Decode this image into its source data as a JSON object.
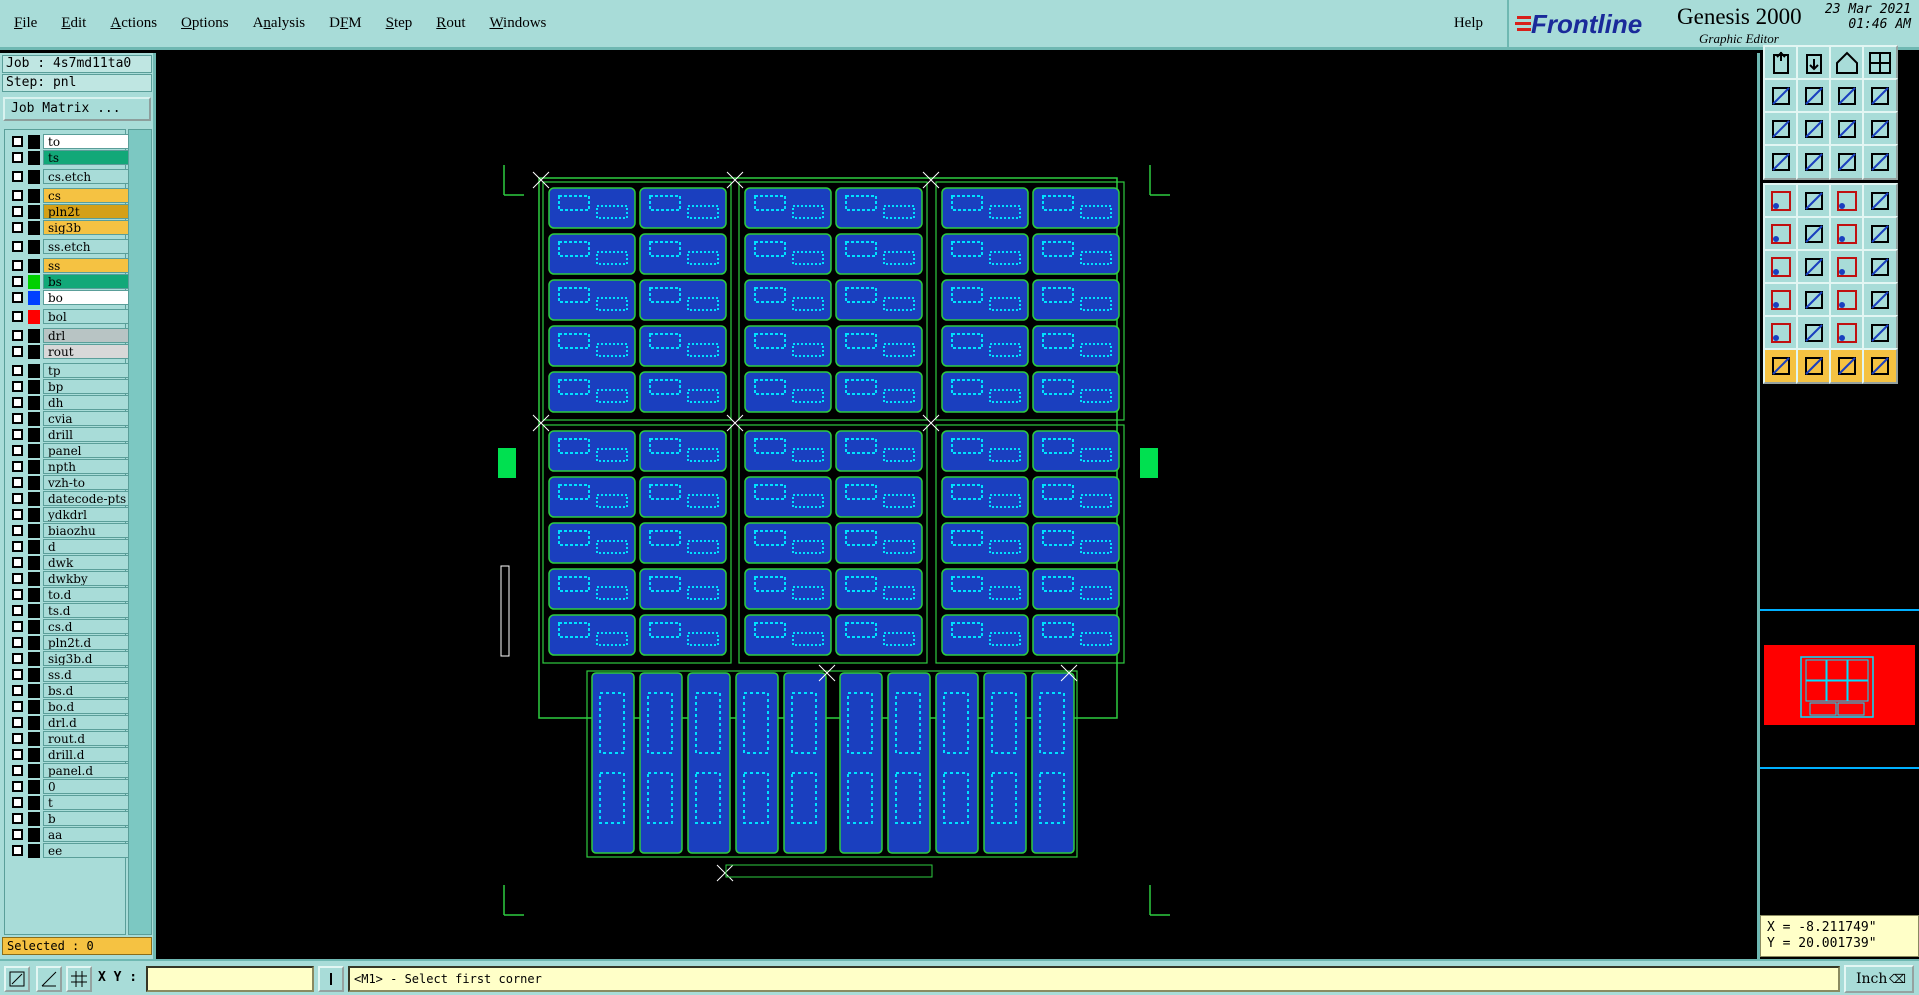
{
  "menu": {
    "items": [
      {
        "key": "file",
        "label": "File"
      },
      {
        "key": "edit",
        "label": "Edit"
      },
      {
        "key": "actions",
        "label": "Actions"
      },
      {
        "key": "options",
        "label": "Options"
      },
      {
        "key": "analysis",
        "label": "Analysis"
      },
      {
        "key": "dfm",
        "label": "DFM"
      },
      {
        "key": "step",
        "label": "Step"
      },
      {
        "key": "rout",
        "label": "Rout"
      },
      {
        "key": "windows",
        "label": "Windows"
      }
    ],
    "help": "Help"
  },
  "brand": {
    "logo": "Frontline",
    "product": "Genesis 2000",
    "subtitle": "Graphic Editor",
    "date": "23 Mar 2021",
    "time": "01:46 AM"
  },
  "job": {
    "job_line": "Job : 4s7md11ta0",
    "step_line": "Step: pnl",
    "matrix_button": "Job Matrix ..."
  },
  "layers": [
    {
      "name": "to",
      "color": "#ffffff",
      "swatch": "#000000",
      "gap": false
    },
    {
      "name": "ts",
      "color": "#12a878",
      "swatch": "#000000",
      "gap": false
    },
    {
      "name": "cs.etch",
      "color": "#a8dcd8",
      "swatch": "#000000",
      "gap": true
    },
    {
      "name": "cs",
      "color": "#f5c242",
      "swatch": "#000000",
      "gap": true
    },
    {
      "name": "pln2t",
      "color": "#d4a017",
      "swatch": "#000000",
      "gap": false
    },
    {
      "name": "sig3b",
      "color": "#f5c242",
      "swatch": "#000000",
      "gap": false
    },
    {
      "name": "ss.etch",
      "color": "#a8dcd8",
      "swatch": "#000000",
      "gap": true
    },
    {
      "name": "ss",
      "color": "#f5c242",
      "swatch": "#000000",
      "gap": true
    },
    {
      "name": "bs",
      "color": "#12a878",
      "swatch": "#00d000",
      "gap": false
    },
    {
      "name": "bo",
      "color": "#ffffff",
      "swatch": "#0040ff",
      "gap": false
    },
    {
      "name": "bol",
      "color": "#a8dcd8",
      "swatch": "#ff0000",
      "gap": true
    },
    {
      "name": "drl",
      "color": "#b8c4c4",
      "swatch": "#000000",
      "gap": true
    },
    {
      "name": "rout",
      "color": "#d8d8d8",
      "swatch": "#000000",
      "gap": false
    },
    {
      "name": "tp",
      "color": "#a8dcd8",
      "swatch": "#000000",
      "gap": true
    },
    {
      "name": "bp",
      "color": "#a8dcd8",
      "swatch": "#000000",
      "gap": false
    },
    {
      "name": "dh",
      "color": "#a8dcd8",
      "swatch": "#000000",
      "gap": false
    },
    {
      "name": "cvia",
      "color": "#a8dcd8",
      "swatch": "#000000",
      "gap": false
    },
    {
      "name": "drill",
      "color": "#a8dcd8",
      "swatch": "#000000",
      "gap": false
    },
    {
      "name": "panel",
      "color": "#a8dcd8",
      "swatch": "#000000",
      "gap": false
    },
    {
      "name": "npth",
      "color": "#a8dcd8",
      "swatch": "#000000",
      "gap": false
    },
    {
      "name": "vzh-to",
      "color": "#a8dcd8",
      "swatch": "#000000",
      "gap": false
    },
    {
      "name": "datecode-pts",
      "color": "#a8dcd8",
      "swatch": "#000000",
      "gap": false
    },
    {
      "name": "ydkdrl",
      "color": "#a8dcd8",
      "swatch": "#000000",
      "gap": false
    },
    {
      "name": "biaozhu",
      "color": "#a8dcd8",
      "swatch": "#000000",
      "gap": false
    },
    {
      "name": "d",
      "color": "#a8dcd8",
      "swatch": "#000000",
      "gap": false
    },
    {
      "name": "dwk",
      "color": "#a8dcd8",
      "swatch": "#000000",
      "gap": false
    },
    {
      "name": "dwkby",
      "color": "#a8dcd8",
      "swatch": "#000000",
      "gap": false
    },
    {
      "name": "to.d",
      "color": "#a8dcd8",
      "swatch": "#000000",
      "gap": false
    },
    {
      "name": "ts.d",
      "color": "#a8dcd8",
      "swatch": "#000000",
      "gap": false
    },
    {
      "name": "cs.d",
      "color": "#a8dcd8",
      "swatch": "#000000",
      "gap": false
    },
    {
      "name": "pln2t.d",
      "color": "#a8dcd8",
      "swatch": "#000000",
      "gap": false
    },
    {
      "name": "sig3b.d",
      "color": "#a8dcd8",
      "swatch": "#000000",
      "gap": false
    },
    {
      "name": "ss.d",
      "color": "#a8dcd8",
      "swatch": "#000000",
      "gap": false
    },
    {
      "name": "bs.d",
      "color": "#a8dcd8",
      "swatch": "#000000",
      "gap": false
    },
    {
      "name": "bo.d",
      "color": "#a8dcd8",
      "swatch": "#000000",
      "gap": false
    },
    {
      "name": "drl.d",
      "color": "#a8dcd8",
      "swatch": "#000000",
      "gap": false
    },
    {
      "name": "rout.d",
      "color": "#a8dcd8",
      "swatch": "#000000",
      "gap": false
    },
    {
      "name": "drill.d",
      "color": "#a8dcd8",
      "swatch": "#000000",
      "gap": false
    },
    {
      "name": "panel.d",
      "color": "#a8dcd8",
      "swatch": "#000000",
      "gap": false
    },
    {
      "name": "0",
      "color": "#a8dcd8",
      "swatch": "#000000",
      "gap": false
    },
    {
      "name": "t",
      "color": "#a8dcd8",
      "swatch": "#000000",
      "gap": false
    },
    {
      "name": "b",
      "color": "#a8dcd8",
      "swatch": "#000000",
      "gap": false
    },
    {
      "name": "aa",
      "color": "#a8dcd8",
      "swatch": "#000000",
      "gap": false
    },
    {
      "name": "ee",
      "color": "#a8dcd8",
      "swatch": "#000000",
      "gap": false
    }
  ],
  "selected": "Selected : 0",
  "toolbar_tools": [
    "zoom-home-icon",
    "zoom-back-icon",
    "home-icon",
    "split-window-icon",
    "pan-left-icon",
    "pan-right-icon",
    "undo-zoom-icon",
    "redo-zoom-icon",
    "fit-screen-icon",
    "zoom-vertical-icon",
    "one-to-one-icon",
    "help-icon",
    "snap-icon",
    "grid-icon",
    "layer-toggle-icon",
    "layer-group-icon",
    "pad-select-icon",
    "polygon-select-icon",
    "ruler-icon",
    "circle-pad-icon",
    "connect-icon",
    "delete-icon",
    "move-icon",
    "copy-icon",
    "line-icon",
    "slash-icon",
    "arc-icon",
    "mirror-icon",
    "pads-icon",
    "dash-icon",
    "resize-icon",
    "ring-icon",
    "arrow-up-icon",
    "triangle-icon",
    "pyramid-icon",
    "pyramid-alt-icon",
    "pointer-icon",
    "select-pointer-icon",
    "pointer-alt-icon",
    "multi-pointer-icon"
  ],
  "colors": {
    "panel": "#a8dcd8",
    "canvas": "#000000",
    "board_outline": "#2ecc40",
    "board_fill": "#1a3fbf",
    "highlight": "#00e0ff",
    "minimap_fill": "#ff0000"
  },
  "coords": {
    "x": "X = -8.211749\"",
    "y": "Y = 20.001739\""
  },
  "status": {
    "xy_label": "X Y :",
    "xy_value": "",
    "prompt": "<M1> - Select first corner",
    "units": "Inch"
  }
}
